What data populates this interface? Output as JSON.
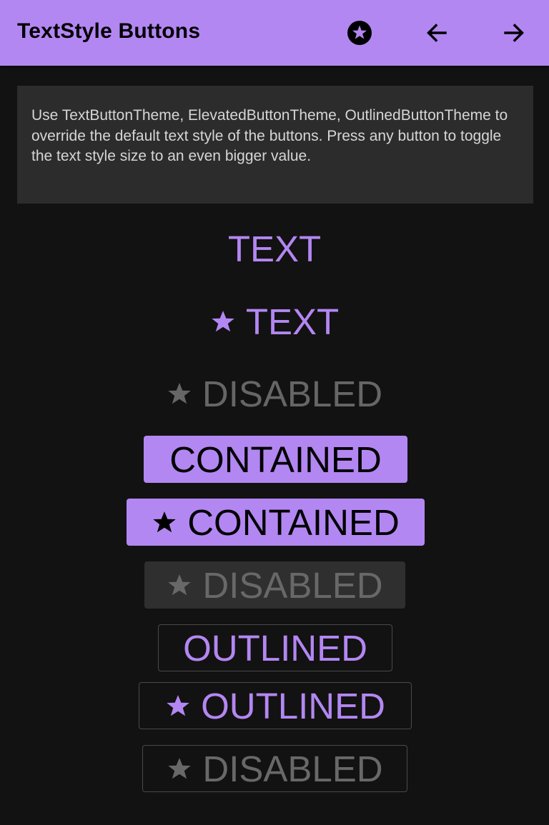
{
  "app_bar": {
    "title": "TextStyle Buttons",
    "background_color": "#b387f2",
    "actions": [
      {
        "icon": "star-circle-icon"
      },
      {
        "icon": "arrow-back-icon"
      },
      {
        "icon": "arrow-forward-icon"
      }
    ]
  },
  "description": "Use TextButtonTheme, ElevatedButtonTheme, OutlinedButtonTheme to override the default text style of the buttons. Press any button to toggle the text style size to an even bigger value.",
  "colors": {
    "accent": "#b387f2",
    "background": "#121212",
    "card": "#2c2c2c",
    "disabled_text": "#666666"
  },
  "buttons": {
    "text": {
      "label": "TEXT"
    },
    "text_icon": {
      "label": "TEXT",
      "icon": "star-icon"
    },
    "text_disabled": {
      "label": "DISABLED",
      "icon": "star-icon"
    },
    "contained": {
      "label": "CONTAINED"
    },
    "contained_icon": {
      "label": "CONTAINED",
      "icon": "star-icon"
    },
    "contained_disabled": {
      "label": "DISABLED",
      "icon": "star-icon"
    },
    "outlined": {
      "label": "OUTLINED"
    },
    "outlined_icon": {
      "label": "OUTLINED",
      "icon": "star-icon"
    },
    "outlined_disabled": {
      "label": "DISABLED",
      "icon": "star-icon"
    }
  }
}
